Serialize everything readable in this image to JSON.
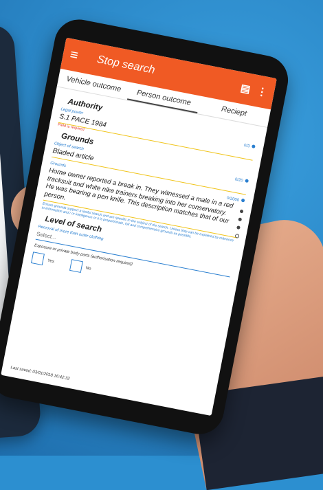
{
  "appbar": {
    "title": "Stop search",
    "menu_icon": "≡",
    "save_icon": "💾",
    "more_icon": "⋮"
  },
  "tabs": [
    "Vehicle outcome",
    "Person outcome",
    "Reciept"
  ],
  "authority": {
    "heading": "Authority",
    "legal_power_label": "Legal power",
    "legal_power_value": "S.1 PACE 1984",
    "legal_power_count": "0/3",
    "required_text": "Field is required"
  },
  "grounds": {
    "heading": "Grounds",
    "object_label": "Object of search",
    "object_value": "Bladed article",
    "object_count": "0/20",
    "grounds_label": "Grounds",
    "grounds_count": "0/2000",
    "grounds_text": "Home owner reported a break in. They witnessed a male in a red tracksuit and white nike trainers breaking into her conservatory. He was bearing a pen knife. This description matches that of our person.",
    "hint": "Ensure grounds support a lawful search and are specific to the subject of the search. Unless they can be explained by reference to information and / or intelligence or it is proportionate, full and comprehensive grounds as possible."
  },
  "level": {
    "heading": "Level of search",
    "removal_label": "Removal of more than outer clothing",
    "select_placeholder": "Select...",
    "exposure_label": "Exposure or private body parts (authorisation required)",
    "yes": "Yes",
    "no": "No"
  },
  "footer": {
    "last_saved": "Last saved: 03/01/2018 16:42:32"
  },
  "colors": {
    "brand": "#f05a24",
    "accent": "#2a7fd0",
    "background": "#2c8fd0"
  }
}
